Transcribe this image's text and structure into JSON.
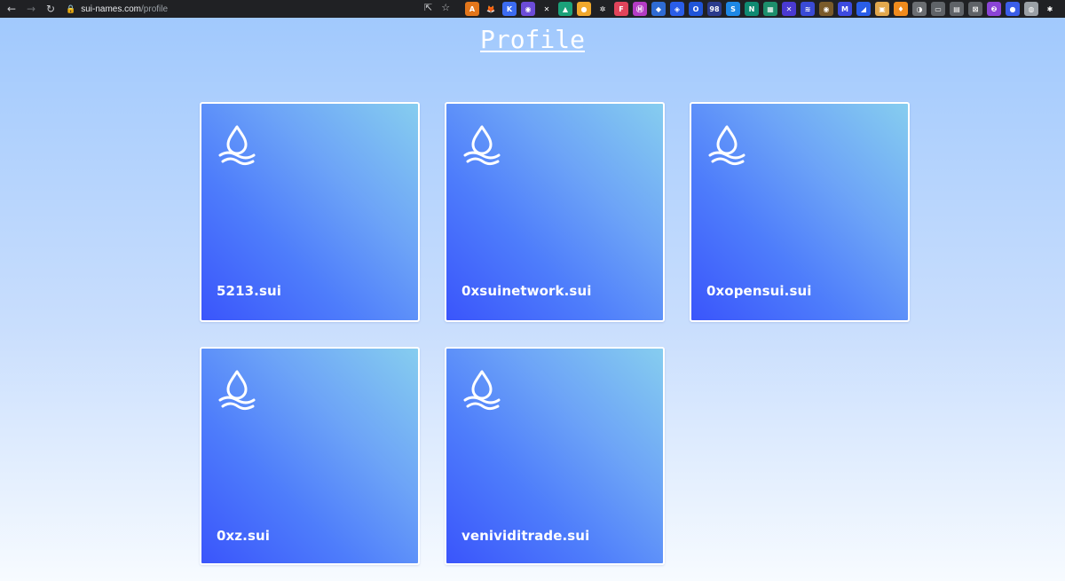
{
  "browser": {
    "url_domain": "sui-names.com",
    "url_path": "/profile",
    "back_icon": "back-arrow-icon",
    "forward_icon": "forward-arrow-icon",
    "reload_icon": "reload-icon"
  },
  "page": {
    "title": "Profile"
  },
  "cards": [
    {
      "name": "5213.sui",
      "icon": "sui-drop-icon"
    },
    {
      "name": "0xsuinetwork.sui",
      "icon": "sui-drop-icon"
    },
    {
      "name": "0xopensui.sui",
      "icon": "sui-drop-icon"
    },
    {
      "name": "0xz.sui",
      "icon": "sui-drop-icon"
    },
    {
      "name": "venividitrade.sui",
      "icon": "sui-drop-icon"
    }
  ],
  "extensions": [
    {
      "label": "A",
      "color": "#e2761b"
    },
    {
      "label": "🦊",
      "color": "#202124"
    },
    {
      "label": "K",
      "color": "#3c6cf1"
    },
    {
      "label": "◉",
      "color": "#6c4cd8"
    },
    {
      "label": "✕",
      "color": "#202124"
    },
    {
      "label": "▲",
      "color": "#1ba27a"
    },
    {
      "label": "●",
      "color": "#f0a82c"
    },
    {
      "label": "✲",
      "color": "#202124"
    },
    {
      "label": "F",
      "color": "#e1445b"
    },
    {
      "label": "Ⓜ",
      "color": "#b43cc4"
    },
    {
      "label": "◆",
      "color": "#2e6bd4"
    },
    {
      "label": "◈",
      "color": "#2a5ee8"
    },
    {
      "label": "O",
      "color": "#1f55d8"
    },
    {
      "label": "98",
      "color": "#2b3c8d"
    },
    {
      "label": "S",
      "color": "#1e88e5"
    },
    {
      "label": "N",
      "color": "#0f8a72"
    },
    {
      "label": "▦",
      "color": "#1d8f6c"
    },
    {
      "label": "✕",
      "color": "#4a3ad1"
    },
    {
      "label": "≋",
      "color": "#3a4bd6"
    },
    {
      "label": "◉",
      "color": "#7a5b2b"
    },
    {
      "label": "M",
      "color": "#3d4be0"
    },
    {
      "label": "◢",
      "color": "#2a5ee8"
    },
    {
      "label": "▣",
      "color": "#e2a84d"
    },
    {
      "label": "♦",
      "color": "#f08b1d"
    },
    {
      "label": "◑",
      "color": "#6b6e72"
    },
    {
      "label": "▭",
      "color": "#5f6368"
    },
    {
      "label": "▤",
      "color": "#5f6368"
    },
    {
      "label": "⊠",
      "color": "#5f6368"
    },
    {
      "label": "❷",
      "color": "#8b44d6"
    },
    {
      "label": "●",
      "color": "#3b5ee8"
    },
    {
      "label": "◍",
      "color": "#9aa0a6"
    },
    {
      "label": "✱",
      "color": "#202124"
    }
  ]
}
